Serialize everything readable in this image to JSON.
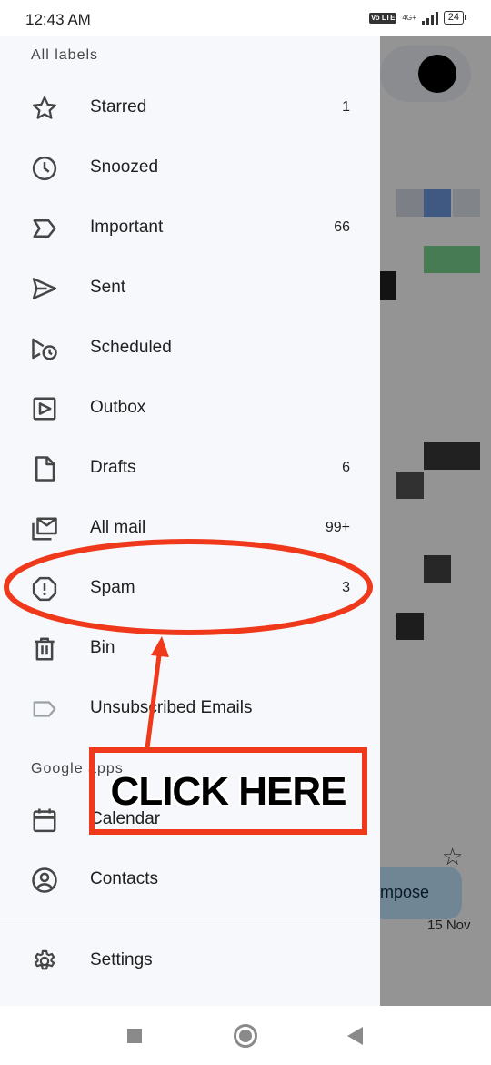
{
  "status_bar": {
    "time": "12:43 AM",
    "volte": "Vo LTE",
    "network": "4G+",
    "battery": "24"
  },
  "drawer": {
    "all_labels_title": "All labels",
    "labels": [
      {
        "label": "Starred",
        "count": "1",
        "icon": "star-icon"
      },
      {
        "label": "Snoozed",
        "count": "",
        "icon": "clock-icon"
      },
      {
        "label": "Important",
        "count": "66",
        "icon": "important-icon"
      },
      {
        "label": "Sent",
        "count": "",
        "icon": "send-icon"
      },
      {
        "label": "Scheduled",
        "count": "",
        "icon": "scheduled-send-icon"
      },
      {
        "label": "Outbox",
        "count": "",
        "icon": "outbox-icon"
      },
      {
        "label": "Drafts",
        "count": "6",
        "icon": "draft-icon"
      },
      {
        "label": "All mail",
        "count": "99+",
        "icon": "all-mail-icon"
      },
      {
        "label": "Spam",
        "count": "3",
        "icon": "spam-icon"
      },
      {
        "label": "Bin",
        "count": "",
        "icon": "trash-icon"
      },
      {
        "label": "Unsubscribed Emails",
        "count": "",
        "icon": "label-icon"
      }
    ],
    "google_apps_title": "Google apps",
    "apps": [
      {
        "label": "Calendar",
        "icon": "calendar-icon"
      },
      {
        "label": "Contacts",
        "icon": "contacts-icon"
      }
    ],
    "settings": {
      "label": "Settings",
      "icon": "gear-icon"
    }
  },
  "background": {
    "compose_label": "mpose",
    "date_label": "15 Nov"
  },
  "annotation": {
    "click_text": "CLICK HERE",
    "color": "#f0391b"
  }
}
